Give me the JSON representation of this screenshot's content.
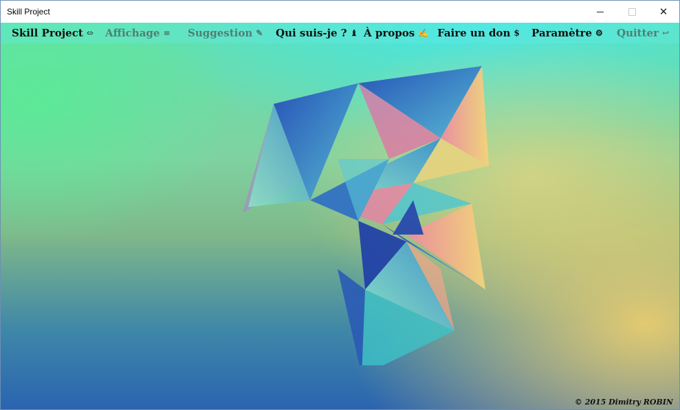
{
  "window": {
    "title": "Skill Project",
    "controls": {
      "minimize": "",
      "maximize": "",
      "close": "✕"
    }
  },
  "menu": [
    {
      "label": "Skill Project",
      "icon": "⬄",
      "icon_name": "link-icon",
      "enabled": true
    },
    {
      "label": "Affichage",
      "icon": "≡",
      "icon_name": "list-icon",
      "enabled": false
    },
    {
      "label": "Suggestion",
      "icon": "✎",
      "icon_name": "pencil-icon",
      "enabled": false
    },
    {
      "label": "Qui suis-je ?",
      "icon": "♝",
      "icon_name": "chess-piece-icon",
      "enabled": true
    },
    {
      "label": "À propos",
      "icon": "✍",
      "icon_name": "hand-icon",
      "enabled": true
    },
    {
      "label": "Faire un don",
      "icon": "$",
      "icon_name": "dollar-icon",
      "enabled": true
    },
    {
      "label": "Paramètre",
      "icon": "⚙",
      "icon_name": "gear-icon",
      "enabled": true
    },
    {
      "label": "Quitter",
      "icon": "↩",
      "icon_name": "exit-icon",
      "enabled": false
    }
  ],
  "footer": {
    "copyright": "© 2015 Dimitry ROBIN"
  },
  "colors": {
    "menu_text": "#111111",
    "menu_disabled": "#4f7f73",
    "background_top": "#46e6e6",
    "background_green": "#5aeb96",
    "background_yellow": "#ebcd6e",
    "background_blue": "#2a64b0"
  }
}
